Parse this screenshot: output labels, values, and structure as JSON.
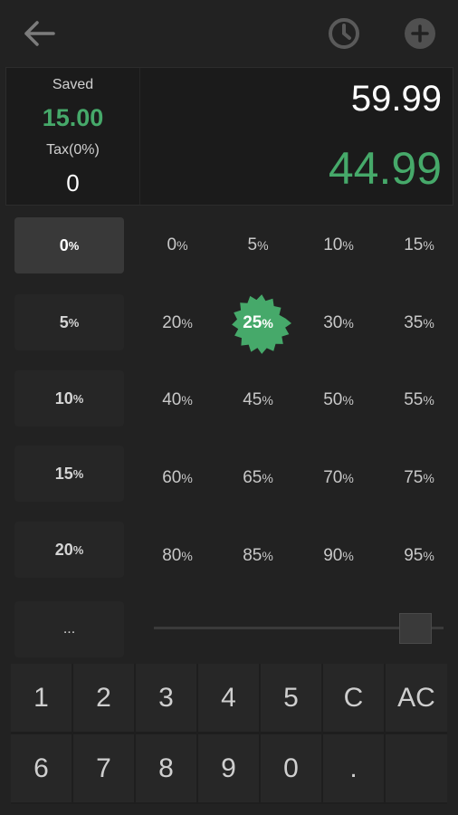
{
  "summary": {
    "saved_label": "Saved",
    "saved_value": "15.00",
    "tax_label": "Tax(0%)",
    "tax_value": "0",
    "price": "59.99",
    "final_price": "44.99"
  },
  "tax_options": [
    {
      "num": "0",
      "unit": "%"
    },
    {
      "num": "5",
      "unit": "%"
    },
    {
      "num": "10",
      "unit": "%"
    },
    {
      "num": "15",
      "unit": "%"
    },
    {
      "num": "20",
      "unit": "%"
    }
  ],
  "tax_more_label": "...",
  "discount_options": [
    {
      "num": "0",
      "unit": "%"
    },
    {
      "num": "5",
      "unit": "%"
    },
    {
      "num": "10",
      "unit": "%"
    },
    {
      "num": "15",
      "unit": "%"
    },
    {
      "num": "20",
      "unit": "%"
    },
    {
      "num": "25",
      "unit": "%"
    },
    {
      "num": "30",
      "unit": "%"
    },
    {
      "num": "35",
      "unit": "%"
    },
    {
      "num": "40",
      "unit": "%"
    },
    {
      "num": "45",
      "unit": "%"
    },
    {
      "num": "50",
      "unit": "%"
    },
    {
      "num": "55",
      "unit": "%"
    },
    {
      "num": "60",
      "unit": "%"
    },
    {
      "num": "65",
      "unit": "%"
    },
    {
      "num": "70",
      "unit": "%"
    },
    {
      "num": "75",
      "unit": "%"
    },
    {
      "num": "80",
      "unit": "%"
    },
    {
      "num": "85",
      "unit": "%"
    },
    {
      "num": "90",
      "unit": "%"
    },
    {
      "num": "95",
      "unit": "%"
    }
  ],
  "selected_tax": "0",
  "selected_discount": "25",
  "slider_value": 0.9,
  "keys": [
    "1",
    "2",
    "3",
    "4",
    "5",
    "C",
    "AC",
    "6",
    "7",
    "8",
    "9",
    "0",
    ".",
    ""
  ],
  "icons": {
    "back": "arrow-left-icon",
    "history": "clock-icon",
    "add": "plus-circle-icon"
  },
  "colors": {
    "background": "#222222",
    "accent_green": "#46a96a",
    "icon_gray": "#5a5a5a"
  }
}
